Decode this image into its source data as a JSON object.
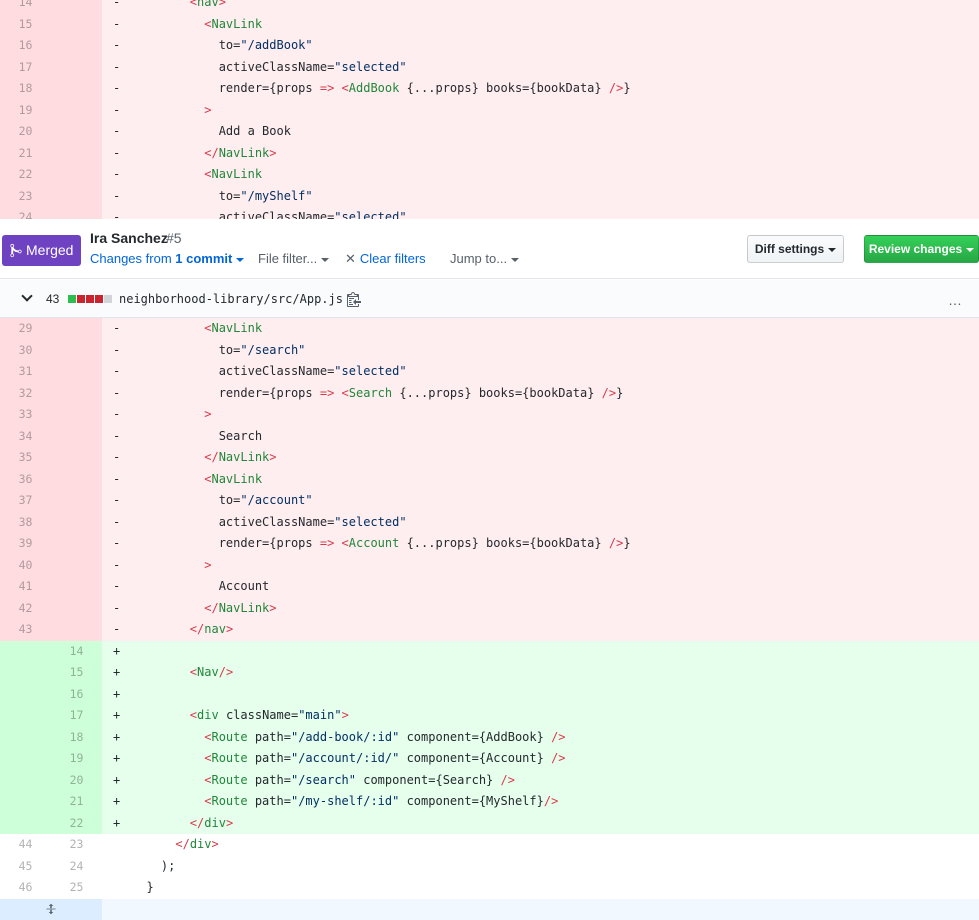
{
  "top_lines": [
    {
      "type": "del",
      "old": "14",
      "new": "",
      "marker": "-",
      "code": "        <nav>"
    },
    {
      "type": "del",
      "old": "15",
      "new": "",
      "marker": "-",
      "code": "          <NavLink"
    },
    {
      "type": "del",
      "old": "16",
      "new": "",
      "marker": "-",
      "code": "            to=\"/addBook\""
    },
    {
      "type": "del",
      "old": "17",
      "new": "",
      "marker": "-",
      "code": "            activeClassName=\"selected\""
    },
    {
      "type": "del",
      "old": "18",
      "new": "",
      "marker": "-",
      "code": "            render={props => <AddBook {...props} books={bookData} />}"
    },
    {
      "type": "del",
      "old": "19",
      "new": "",
      "marker": "-",
      "code": "          >"
    },
    {
      "type": "del",
      "old": "20",
      "new": "",
      "marker": "-",
      "code": "            Add a Book"
    },
    {
      "type": "del",
      "old": "21",
      "new": "",
      "marker": "-",
      "code": "          </NavLink>"
    },
    {
      "type": "del",
      "old": "22",
      "new": "",
      "marker": "-",
      "code": "          <NavLink"
    },
    {
      "type": "del",
      "old": "23",
      "new": "",
      "marker": "-",
      "code": "            to=\"/myShelf\""
    },
    {
      "type": "del",
      "old": "24",
      "new": "",
      "marker": "-",
      "code": "            activeClassName=\"selected\""
    }
  ],
  "pr_header": {
    "badge": "Merged",
    "author": "Ira Sanchez",
    "number": "#5",
    "changes_prefix": "Changes from ",
    "changes_count": "1 commit",
    "file_filter": "File filter...",
    "clear_filters": "Clear filters",
    "jump_to": "Jump to...",
    "diff_settings": "Diff settings",
    "review_changes": "Review changes"
  },
  "file_header": {
    "count": "43",
    "path": "neighborhood-library/src/App.js",
    "more": "…",
    "colors": {
      "add": "#2cbe4e",
      "del": "#cb2431",
      "neutral": "#d1d5da"
    }
  },
  "main_lines": [
    {
      "type": "del",
      "old": "29",
      "new": "",
      "marker": "-",
      "code": "          <NavLink"
    },
    {
      "type": "del",
      "old": "30",
      "new": "",
      "marker": "-",
      "code": "            to=\"/search\""
    },
    {
      "type": "del",
      "old": "31",
      "new": "",
      "marker": "-",
      "code": "            activeClassName=\"selected\""
    },
    {
      "type": "del",
      "old": "32",
      "new": "",
      "marker": "-",
      "code": "            render={props => <Search {...props} books={bookData} />}"
    },
    {
      "type": "del",
      "old": "33",
      "new": "",
      "marker": "-",
      "code": "          >"
    },
    {
      "type": "del",
      "old": "34",
      "new": "",
      "marker": "-",
      "code": "            Search"
    },
    {
      "type": "del",
      "old": "35",
      "new": "",
      "marker": "-",
      "code": "          </NavLink>"
    },
    {
      "type": "del",
      "old": "36",
      "new": "",
      "marker": "-",
      "code": "          <NavLink"
    },
    {
      "type": "del",
      "old": "37",
      "new": "",
      "marker": "-",
      "code": "            to=\"/account\""
    },
    {
      "type": "del",
      "old": "38",
      "new": "",
      "marker": "-",
      "code": "            activeClassName=\"selected\""
    },
    {
      "type": "del",
      "old": "39",
      "new": "",
      "marker": "-",
      "code": "            render={props => <Account {...props} books={bookData} />}"
    },
    {
      "type": "del",
      "old": "40",
      "new": "",
      "marker": "-",
      "code": "          >"
    },
    {
      "type": "del",
      "old": "41",
      "new": "",
      "marker": "-",
      "code": "            Account"
    },
    {
      "type": "del",
      "old": "42",
      "new": "",
      "marker": "-",
      "code": "          </NavLink>"
    },
    {
      "type": "del",
      "old": "43",
      "new": "",
      "marker": "-",
      "code": "        </nav>"
    },
    {
      "type": "add",
      "old": "",
      "new": "14",
      "marker": "+",
      "code": ""
    },
    {
      "type": "add",
      "old": "",
      "new": "15",
      "marker": "+",
      "code": "        <Nav/>"
    },
    {
      "type": "add",
      "old": "",
      "new": "16",
      "marker": "+",
      "code": ""
    },
    {
      "type": "add",
      "old": "",
      "new": "17",
      "marker": "+",
      "code": "        <div className=\"main\">"
    },
    {
      "type": "add",
      "old": "",
      "new": "18",
      "marker": "+",
      "code": "          <Route path=\"/add-book/:id\" component={AddBook} />"
    },
    {
      "type": "add",
      "old": "",
      "new": "19",
      "marker": "+",
      "code": "          <Route path=\"/account/:id/\" component={Account} />"
    },
    {
      "type": "add",
      "old": "",
      "new": "20",
      "marker": "+",
      "code": "          <Route path=\"/search\" component={Search} />"
    },
    {
      "type": "add",
      "old": "",
      "new": "21",
      "marker": "+",
      "code": "          <Route path=\"/my-shelf/:id\" component={MyShelf}/>"
    },
    {
      "type": "add",
      "old": "",
      "new": "22",
      "marker": "+",
      "code": "        </div>"
    },
    {
      "type": "ctx",
      "old": "44",
      "new": "23",
      "marker": "",
      "code": "      </div>"
    },
    {
      "type": "ctx",
      "old": "45",
      "new": "24",
      "marker": "",
      "code": "    );"
    },
    {
      "type": "ctx",
      "old": "46",
      "new": "25",
      "marker": "",
      "code": "  }"
    }
  ],
  "expand_icon": "expand-icon"
}
